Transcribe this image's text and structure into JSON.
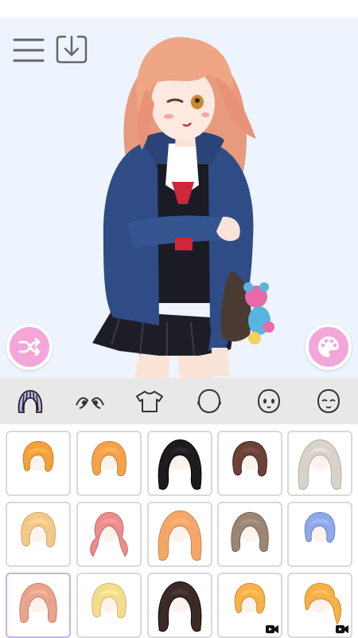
{
  "toolbar": {
    "menu_icon": "hamburger-menu-icon",
    "download_icon": "download-icon"
  },
  "actions": {
    "shuffle_icon": "shuffle-icon",
    "palette_icon": "palette-icon"
  },
  "colors": {
    "accent_pink": "#f4a6d8",
    "tab_bar_bg": "#e8e8e8",
    "selected_tab_icon": "#a57fd6",
    "selected_cell_border": "#c8b3ea",
    "canvas_bg": "#eef4fd"
  },
  "tabs": [
    {
      "icon": "hair-icon",
      "selected": true
    },
    {
      "icon": "eyes-icon",
      "selected": false
    },
    {
      "icon": "clothes-icon",
      "selected": false
    },
    {
      "icon": "head-shape-icon",
      "selected": false
    },
    {
      "icon": "face-expression-icon",
      "selected": false
    },
    {
      "icon": "face-icon",
      "selected": false
    }
  ],
  "hair_items": [
    {
      "color": "#f1a23c",
      "style": "short",
      "selected": false,
      "video_locked": false
    },
    {
      "color": "#f5a24a",
      "style": "bob-side",
      "selected": false,
      "video_locked": false
    },
    {
      "color": "#1e1a1f",
      "style": "long-wavy",
      "selected": false,
      "video_locked": false
    },
    {
      "color": "#6a4238",
      "style": "wavy-bob",
      "selected": false,
      "video_locked": false
    },
    {
      "color": "#d9d2c8",
      "style": "long-straight",
      "selected": false,
      "video_locked": false
    },
    {
      "color": "#f3c98a",
      "style": "bob-ribbon",
      "selected": false,
      "video_locked": false
    },
    {
      "color": "#ec8c8c",
      "style": "twin-tails",
      "selected": false,
      "video_locked": false
    },
    {
      "color": "#f3a86a",
      "style": "long-wavy",
      "selected": false,
      "video_locked": false
    },
    {
      "color": "#9b8676",
      "style": "medium-layered",
      "selected": false,
      "video_locked": false
    },
    {
      "color": "#8ea8e8",
      "style": "short-bob",
      "selected": false,
      "video_locked": false
    },
    {
      "color": "#e9a58c",
      "style": "medium-gradient",
      "selected": true,
      "video_locked": false
    },
    {
      "color": "#f5dc8c",
      "style": "curly-bob",
      "selected": false,
      "video_locked": false
    },
    {
      "color": "#3b2a26",
      "style": "long-wavy",
      "selected": false,
      "video_locked": false
    },
    {
      "color": "#f5b24a",
      "style": "short-fluffy",
      "selected": false,
      "video_locked": true
    },
    {
      "color": "#f5b04a",
      "style": "ponytail",
      "selected": false,
      "video_locked": true
    }
  ]
}
